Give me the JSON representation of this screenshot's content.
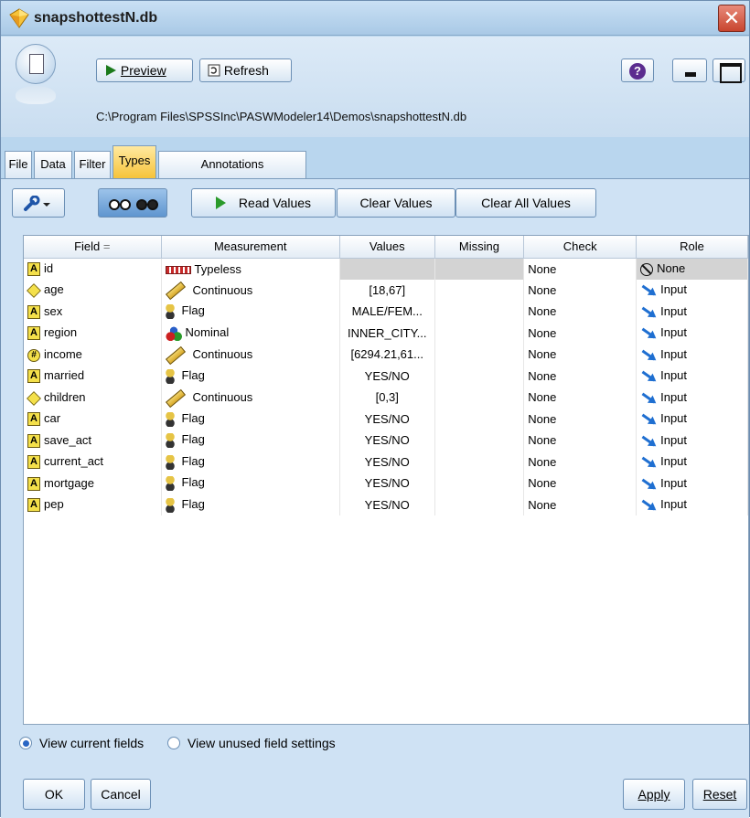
{
  "window": {
    "title": "snapshottestN.db",
    "close_icon": "✕"
  },
  "toolbar": {
    "preview_label": "Preview",
    "refresh_label": "Refresh",
    "help_icon": "?",
    "path": "C:\\Program Files\\SPSSInc\\PASWModeler14\\Demos\\snapshottestN.db"
  },
  "tabs": [
    {
      "label": "File"
    },
    {
      "label": "Data"
    },
    {
      "label": "Filter"
    },
    {
      "label": "Types",
      "active": true
    },
    {
      "label": "Annotations"
    }
  ],
  "types_toolbar": {
    "read_values": "Read Values",
    "clear_values": "Clear Values",
    "clear_all_values": "Clear All Values"
  },
  "table": {
    "headers": [
      "Field",
      "Measurement",
      "Values",
      "Missing",
      "Check",
      "Role"
    ],
    "sort_indicator": "=",
    "rows": [
      {
        "field": "id",
        "field_icon": "string-icon",
        "measurement": "Typeless",
        "values": "",
        "missing": "",
        "check": "None",
        "role": "None"
      },
      {
        "field": "age",
        "field_icon": "integer-icon",
        "measurement": "Continuous",
        "values": "[18,67]",
        "missing": "",
        "check": "None",
        "role": "Input"
      },
      {
        "field": "sex",
        "field_icon": "string-icon",
        "measurement": "Flag",
        "values": "MALE/FEM...",
        "missing": "",
        "check": "None",
        "role": "Input"
      },
      {
        "field": "region",
        "field_icon": "string-icon",
        "measurement": "Nominal",
        "values": "INNER_CITY...",
        "missing": "",
        "check": "None",
        "role": "Input"
      },
      {
        "field": "income",
        "field_icon": "real-icon",
        "measurement": "Continuous",
        "values": "[6294.21,61...",
        "missing": "",
        "check": "None",
        "role": "Input"
      },
      {
        "field": "married",
        "field_icon": "string-icon",
        "measurement": "Flag",
        "values": "YES/NO",
        "missing": "",
        "check": "None",
        "role": "Input"
      },
      {
        "field": "children",
        "field_icon": "integer-icon",
        "measurement": "Continuous",
        "values": "[0,3]",
        "missing": "",
        "check": "None",
        "role": "Input"
      },
      {
        "field": "car",
        "field_icon": "string-icon",
        "measurement": "Flag",
        "values": "YES/NO",
        "missing": "",
        "check": "None",
        "role": "Input"
      },
      {
        "field": "save_act",
        "field_icon": "string-icon",
        "measurement": "Flag",
        "values": "YES/NO",
        "missing": "",
        "check": "None",
        "role": "Input"
      },
      {
        "field": "current_act",
        "field_icon": "string-icon",
        "measurement": "Flag",
        "values": "YES/NO",
        "missing": "",
        "check": "None",
        "role": "Input"
      },
      {
        "field": "mortgage",
        "field_icon": "string-icon",
        "measurement": "Flag",
        "values": "YES/NO",
        "missing": "",
        "check": "None",
        "role": "Input"
      },
      {
        "field": "pep",
        "field_icon": "string-icon",
        "measurement": "Flag",
        "values": "YES/NO",
        "missing": "",
        "check": "None",
        "role": "Input"
      }
    ]
  },
  "view_options": {
    "current_fields": "View current fields",
    "unused_settings": "View unused field settings",
    "selected": "current_fields"
  },
  "footer": {
    "ok": "OK",
    "cancel": "Cancel",
    "apply": "Apply",
    "reset": "Reset"
  },
  "colors": {
    "active_tab": "#f6c33a",
    "window_bg": "#b9d6ee",
    "close_button": "#c8452f"
  }
}
